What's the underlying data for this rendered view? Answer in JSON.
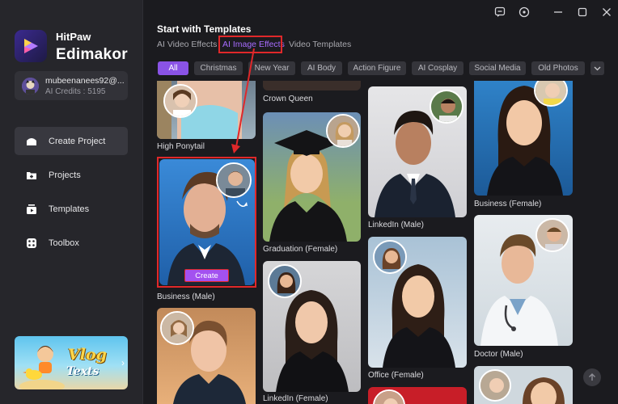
{
  "app": {
    "brand_line1": "HitPaw",
    "brand_line2": "Edimakor",
    "accent_color": "#a351f0",
    "highlight_color": "#e0282a"
  },
  "user": {
    "name": "mubeenanees92@...",
    "credits": "AI Credits : 5195"
  },
  "nav": [
    {
      "label": "Create Project",
      "icon": "create-project-icon",
      "active": true
    },
    {
      "label": "Projects",
      "icon": "projects-icon"
    },
    {
      "label": "Templates",
      "icon": "templates-icon"
    },
    {
      "label": "Toolbox",
      "icon": "toolbox-icon"
    }
  ],
  "promo": {
    "line1": "Vlog",
    "line2": "Texts"
  },
  "window_controls": [
    "feedback-icon",
    "settings-icon",
    "minimize-icon",
    "maximize-icon",
    "close-icon"
  ],
  "main": {
    "title": "Start with Templates",
    "tabs": [
      "AI Video Effects",
      "AI Image Effects",
      "Video Templates"
    ],
    "active_tab": "AI Image Effects",
    "chips": [
      "All",
      "Christmas",
      "New Year",
      "AI Body",
      "Action Figure",
      "AI Cosplay",
      "Social Media",
      "Old Photos"
    ],
    "active_chip": "All"
  },
  "cards": [
    {
      "label": "High Ponytail"
    },
    {
      "label": "Business (Male)",
      "button": "Create"
    },
    {
      "label": ""
    },
    {
      "label": "Crown Queen"
    },
    {
      "label": "Graduation (Female)"
    },
    {
      "label": "LinkedIn (Female)"
    },
    {
      "label": "LinkedIn (Male)"
    },
    {
      "label": "Office (Female)"
    },
    {
      "label": ""
    },
    {
      "label": "Business (Female)"
    },
    {
      "label": "Doctor (Male)"
    },
    {
      "label": ""
    }
  ]
}
